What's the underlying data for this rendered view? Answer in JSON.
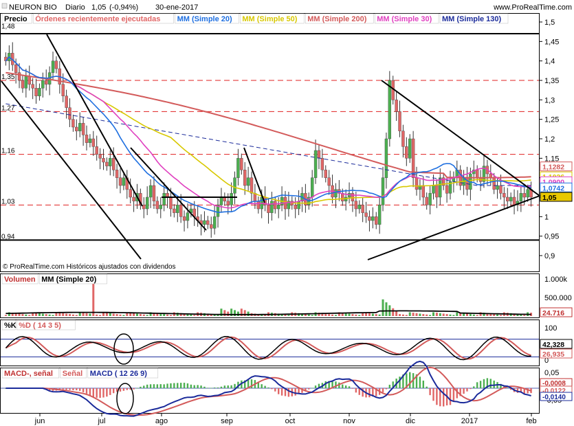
{
  "header": {
    "instrument": "NEURON BIO",
    "period": "Diario",
    "last": "1,05",
    "change": "(-0,94%)",
    "date": "30-ene-2017",
    "site": "www.ProRealTime.com"
  },
  "legend_price": [
    {
      "label": "Precio",
      "color": "#000000"
    },
    {
      "label": "Órdenes recientemente ejecutadas",
      "color": "#e06666"
    },
    {
      "label": "MM (Simple 20)",
      "color": "#1e6fe0"
    },
    {
      "label": "MM (Simple 50)",
      "color": "#d8c800"
    },
    {
      "label": "MM (Simple 200)",
      "color": "#d35a5a"
    },
    {
      "label": "MM (Simple 30)",
      "color": "#e040c0"
    },
    {
      "label": "MM (Simple 130)",
      "color": "#1a2a9a"
    }
  ],
  "copyright": "© ProRealTime.com  Históricos ajustados con dividendos",
  "volume_panel": {
    "legend": [
      {
        "label": "Volumen",
        "color": "#c03030"
      },
      {
        "label": "MM (Simple 20)",
        "color": "#000000"
      }
    ],
    "ticks": [
      "1.000k",
      "500.000"
    ],
    "value_tag": "24.716"
  },
  "stoch_panel": {
    "legend": [
      {
        "label": "%K",
        "color": "#000000"
      },
      {
        "label": "%D ( 14 3 5)",
        "color": "#d35a5a"
      }
    ],
    "ticks": [
      "100",
      "0"
    ],
    "tags": [
      "42,328",
      "26,935"
    ]
  },
  "macd_panel": {
    "legend": [
      {
        "label": "MACD-, señal",
        "color": "#c03030"
      },
      {
        "label": "Señal",
        "color": "#d35a5a"
      },
      {
        "label": "MACD ( 12 26 9)",
        "color": "#1a2a9a"
      }
    ],
    "ticks": [
      "0,05",
      "-0,05"
    ],
    "tags": [
      "-0,0008",
      "-0,0122",
      "-0,0140"
    ]
  },
  "x_labels": [
    "jun",
    "jul",
    "ago",
    "sep",
    "oct",
    "nov",
    "dic",
    "2017",
    "feb"
  ],
  "chart_data": {
    "type": "candlestick",
    "y_axis_ticks": [
      "1,5",
      "1,45",
      "1,4",
      "1,35",
      "1,3",
      "1,25",
      "1,2",
      "1,15",
      "1,1",
      "1,05",
      "1",
      "0,95",
      "0,9"
    ],
    "ylim": [
      0.88,
      1.52
    ],
    "left_labels": [
      "1,48",
      "1,35",
      "1,27",
      "1,16",
      "1,03",
      "0,94"
    ],
    "support_resistance": [
      1.35,
      1.27,
      1.16,
      1.03
    ],
    "solid_levels": [
      1.47,
      0.94
    ],
    "price_tags": [
      {
        "text": "1,1282",
        "value": 1.1282,
        "color": "#d35a5a"
      },
      {
        "text": "1,1026",
        "value": 1.1026,
        "color": "#d8c800"
      },
      {
        "text": "1,0900",
        "value": 1.09,
        "color": "#e040c0"
      },
      {
        "text": "1,0742",
        "value": 1.0742,
        "color": "#1e6fe0"
      },
      {
        "text": "1,05",
        "value": 1.05,
        "color": "#000000"
      }
    ],
    "close_series": [
      1.4,
      1.42,
      1.39,
      1.37,
      1.35,
      1.33,
      1.36,
      1.34,
      1.33,
      1.31,
      1.33,
      1.35,
      1.34,
      1.37,
      1.4,
      1.38,
      1.34,
      1.31,
      1.28,
      1.25,
      1.23,
      1.22,
      1.24,
      1.21,
      1.19,
      1.2,
      1.18,
      1.16,
      1.15,
      1.14,
      1.13,
      1.15,
      1.12,
      1.1,
      1.08,
      1.1,
      1.07,
      1.05,
      1.04,
      1.06,
      1.03,
      1.02,
      1.05,
      1.08,
      1.04,
      1.02,
      1.03,
      1.06,
      1.05,
      1.02,
      1.01,
      1.03,
      1.0,
      0.99,
      1.01,
      1.02,
      1.0,
      0.99,
      0.98,
      0.99,
      0.98,
      0.97,
      1.0,
      1.03,
      1.05,
      1.04,
      1.03,
      1.06,
      1.1,
      1.15,
      1.12,
      1.08,
      1.1,
      1.06,
      1.04,
      1.02,
      1.05,
      1.03,
      1.01,
      1.04,
      1.02,
      1.03,
      1.05,
      1.02,
      1.04,
      1.03,
      1.02,
      1.04,
      1.06,
      1.03,
      1.05,
      1.1,
      1.17,
      1.15,
      1.12,
      1.1,
      1.08,
      1.05,
      1.07,
      1.06,
      1.04,
      1.05,
      1.06,
      1.04,
      1.02,
      1.03,
      1.01,
      1.0,
      0.99,
      1.0,
      0.98,
      1.03,
      1.1,
      1.2,
      1.35,
      1.3,
      1.27,
      1.22,
      1.18,
      1.15,
      1.2,
      1.1,
      1.07,
      1.08,
      1.05,
      1.03,
      1.06,
      1.08,
      1.05,
      1.1,
      1.08,
      1.06,
      1.09,
      1.1,
      1.12,
      1.08,
      1.1,
      1.07,
      1.11,
      1.12,
      1.1,
      1.09,
      1.13,
      1.11,
      1.1,
      1.07,
      1.08,
      1.06,
      1.05,
      1.04,
      1.05,
      1.03,
      1.04,
      1.06,
      1.05,
      1.07,
      1.05
    ]
  }
}
